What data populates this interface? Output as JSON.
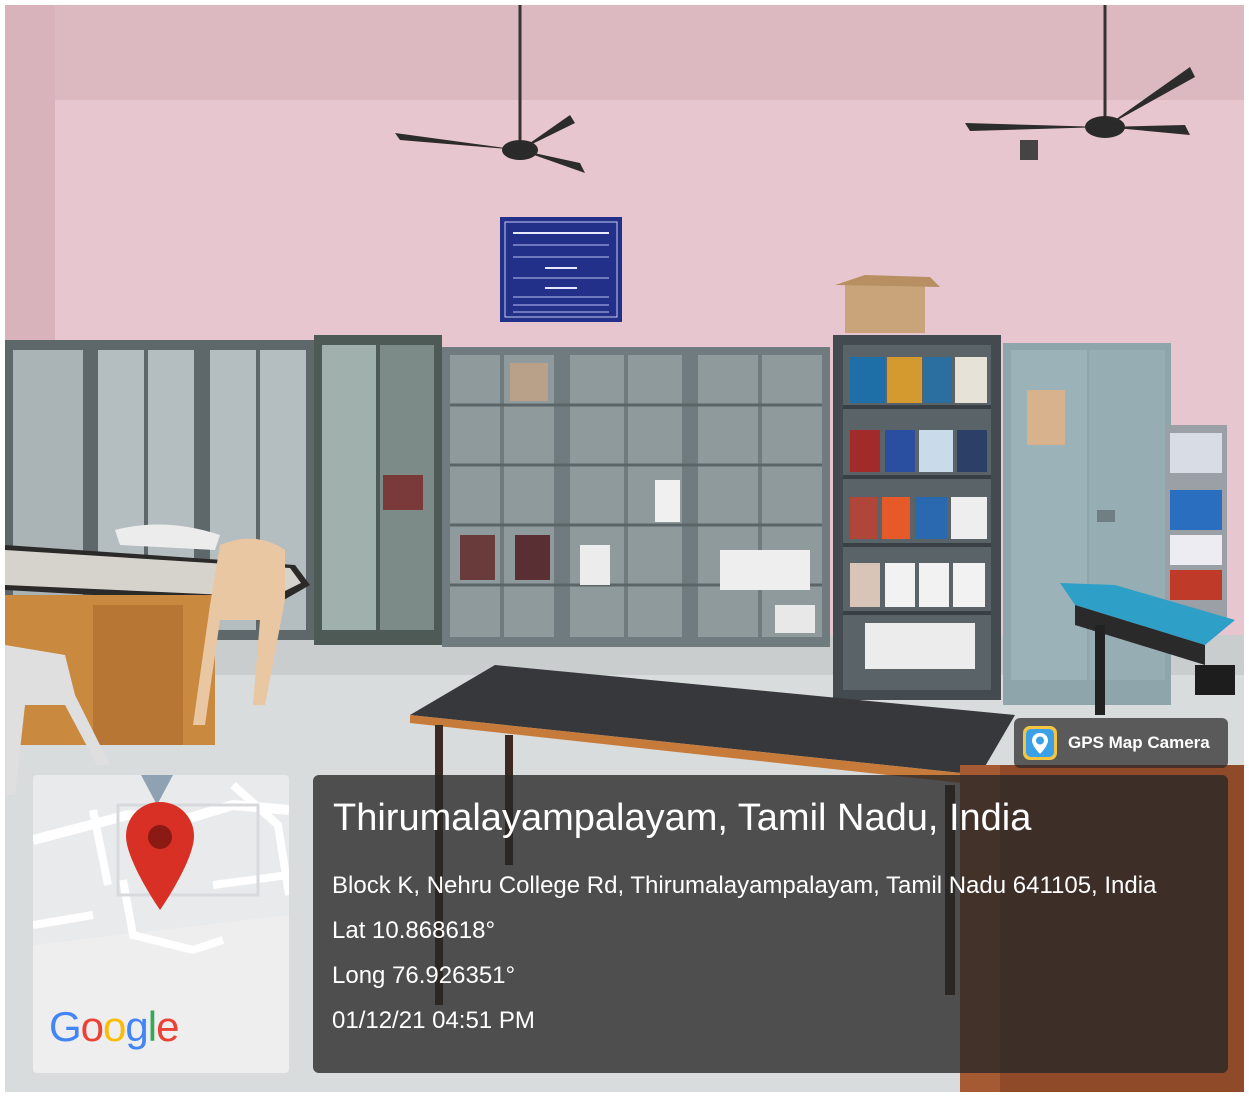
{
  "app_badge": {
    "label": "GPS Map Camera",
    "icon": "gps-map-camera-icon"
  },
  "map": {
    "brand": "Google",
    "pin_color": "#d93025"
  },
  "location": {
    "title": "Thirumalayampalayam, Tamil Nadu, India",
    "address": "Block K, Nehru College Rd, Thirumalayampalayam, Tamil Nadu 641105, India",
    "latitude": "Lat 10.868618°",
    "longitude": "Long 76.926351°",
    "datetime": "01/12/21 04:51 PM"
  },
  "colors": {
    "wall": "#e8c6cf",
    "floor": "#d9dcdc",
    "cabinet": "#6f7b7e",
    "overlay": "#262626"
  }
}
